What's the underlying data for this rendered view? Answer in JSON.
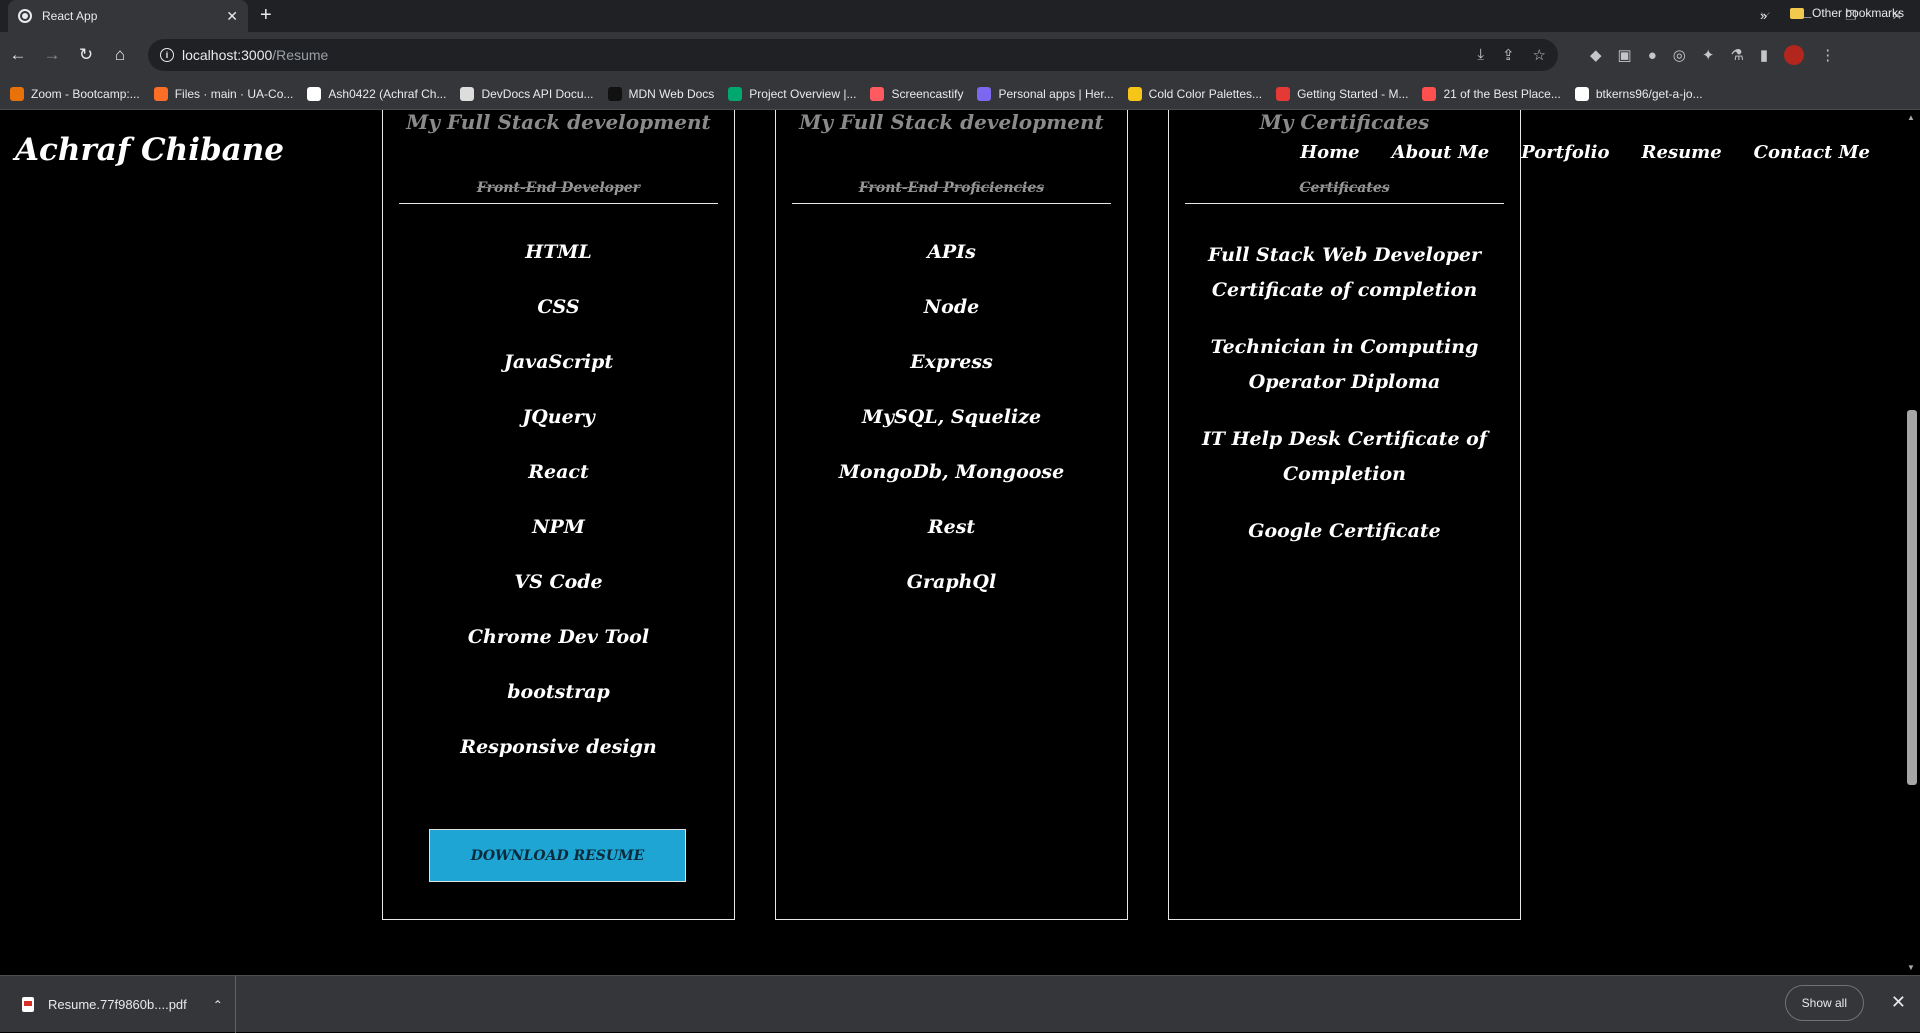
{
  "browser": {
    "tab_title": "React App",
    "tab_close": "✕",
    "new_tab": "+",
    "url_host": "localhost:3000",
    "url_path": "/Resume",
    "bookmarks": [
      {
        "label": "Zoom - Bootcamp:...",
        "color": "#e8710a"
      },
      {
        "label": "Files · main · UA-Co...",
        "color": "#fc6d26"
      },
      {
        "label": "Ash0422 (Achraf Ch...",
        "color": "#ffffff"
      },
      {
        "label": "DevDocs API Docu...",
        "color": "#dddddd"
      },
      {
        "label": "MDN Web Docs",
        "color": "#111111"
      },
      {
        "label": "Project Overview |...",
        "color": "#00a870"
      },
      {
        "label": "Screencastify",
        "color": "#ff5a5f"
      },
      {
        "label": "Personal apps | Her...",
        "color": "#7b68ee"
      },
      {
        "label": "Cold Color Palettes...",
        "color": "#f5c518"
      },
      {
        "label": "Getting Started - M...",
        "color": "#e53935"
      },
      {
        "label": "21 of the Best Place...",
        "color": "#ff4f4f"
      },
      {
        "label": "btkerns96/get-a-jo...",
        "color": "#ffffff"
      }
    ],
    "bookmarks_more": "»",
    "other_bookmarks": "Other bookmarks"
  },
  "site": {
    "brand": "Achraf Chibane",
    "nav": [
      "Home",
      "About Me",
      "Portfolio",
      "Resume",
      "Contact Me"
    ],
    "columns": [
      {
        "heading": "My Full Stack development",
        "subheading": "Front-End Developer",
        "items": [
          "HTML",
          "CSS",
          "JavaScript",
          "JQuery",
          "React",
          "NPM",
          "VS Code",
          "Chrome Dev Tool",
          "bootstrap",
          "Responsive design"
        ],
        "button": "DOWNLOAD RESUME"
      },
      {
        "heading": "My Full Stack development",
        "subheading": "Front-End Proficiencies",
        "items": [
          "APIs",
          "Node",
          "Express",
          "MySQL, Squelize",
          "MongoDb, Mongoose",
          "Rest",
          "GraphQl"
        ]
      },
      {
        "heading": "My Certificates",
        "subheading": "Certificates",
        "items": [
          "Full Stack Web Developer Certificate of completion",
          "Technician in Computing Operator Diploma",
          "IT Help Desk Certificate of Completion",
          "Google Certificate"
        ]
      }
    ]
  },
  "downloads": {
    "file": "Resume.77f9860b....pdf",
    "show_all": "Show all"
  }
}
